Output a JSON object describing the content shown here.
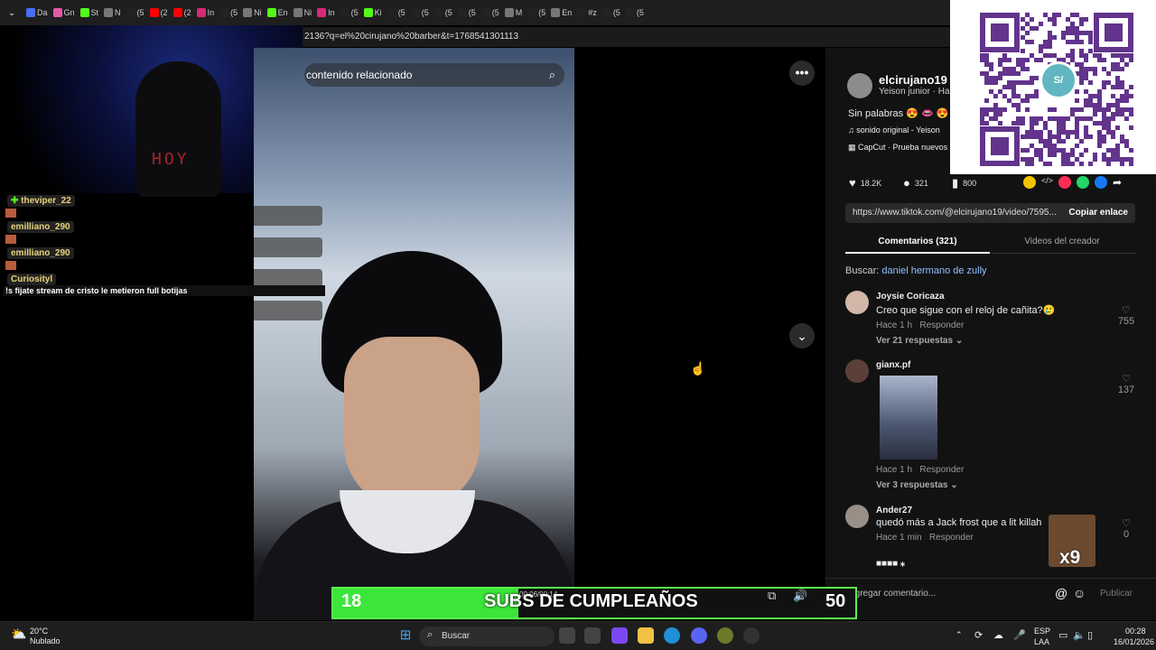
{
  "browser": {
    "tabs": [
      {
        "label": "Da",
        "color": "#4a6cf7"
      },
      {
        "label": "Gn",
        "color": "#e05aa5"
      },
      {
        "label": "St",
        "color": "#53fc18"
      },
      {
        "label": "N",
        "color": "#777"
      },
      {
        "label": "(5",
        "color": "#222"
      },
      {
        "label": "(2",
        "color": "#ff0000"
      },
      {
        "label": "(2",
        "color": "#ff0000"
      },
      {
        "label": "In",
        "color": "#d62976"
      },
      {
        "label": "(5",
        "color": "#222"
      },
      {
        "label": "Ni",
        "color": "#777"
      },
      {
        "label": "En",
        "color": "#53fc18"
      },
      {
        "label": "Ni",
        "color": "#777"
      },
      {
        "label": "In",
        "color": "#d62976"
      },
      {
        "label": "(5",
        "color": "#222"
      },
      {
        "label": "Ki",
        "color": "#53fc18"
      },
      {
        "label": "(5",
        "color": "#222"
      },
      {
        "label": "(5",
        "color": "#222"
      },
      {
        "label": "(5",
        "color": "#222"
      },
      {
        "label": "(5",
        "color": "#222"
      },
      {
        "label": "(5",
        "color": "#222"
      },
      {
        "label": "M",
        "color": "#777"
      },
      {
        "label": "(5",
        "color": "#222"
      },
      {
        "label": "En",
        "color": "#777"
      },
      {
        "label": "#z",
        "color": "#222"
      },
      {
        "label": "(5",
        "color": "#222"
      },
      {
        "label": "(5",
        "color": "#222"
      }
    ],
    "url": "2136?q=el%20cirujano%20barber&t=1768541301113"
  },
  "overlay": {
    "webcam_text": "HOY",
    "chat": [
      {
        "user": "theviper_22",
        "badge": "✚",
        "msg": ""
      },
      {
        "user": "emilliano_290",
        "badge": "",
        "msg": ""
      },
      {
        "user": "emilliano_290",
        "badge": "",
        "msg": ""
      },
      {
        "user": "Curiosityl",
        "badge": "",
        "msg": "!s fijate stream de cristo le metieron full botijas"
      }
    ],
    "subs_count": "18",
    "subs_title": "SUBS DE CUMPLEAÑOS",
    "subs_goal": "50",
    "time": "00:06/00:14",
    "meme": "x9"
  },
  "video": {
    "search_placeholder": "contenido relacionado",
    "search_icon": "search-icon",
    "more_label": "•••",
    "down_label": "⌄"
  },
  "post": {
    "author": "elcirujano19",
    "author_sub": "Yeison junior · Hac",
    "caption": "Sin palabras 😍 👄 😍 #",
    "sound": "♫  sonido original - Yeison",
    "capcut": "CapCut · Prueba nuevos",
    "likes": "18.2K",
    "comments": "321",
    "saves": "800",
    "link": "https://www.tiktok.com/@elcirujano19/video/7595...",
    "copy_label": "Copiar enlace",
    "tab_comments": "Comentarios (321)",
    "tab_videos": "Videos del creador",
    "search_prefix": "Buscar:",
    "search_term": "daniel hermano de zully"
  },
  "comments": [
    {
      "name": "Joysie Coricaza",
      "text": "Creo que sigue con el reloj de cañita?🥲",
      "time": "Hace 1 h",
      "reply": "Responder",
      "likes": "755",
      "replies": "Ver 21 respuestas ⌄"
    },
    {
      "name": "gianx.pf",
      "text": "",
      "time": "Hace 1 h",
      "reply": "Responder",
      "likes": "137",
      "replies": "Ver 3 respuestas ⌄"
    },
    {
      "name": "Ander27",
      "text": "quedó más a Jack frost que a lit killah",
      "time": "Hace 1 min",
      "reply": "Responder",
      "likes": "0",
      "replies": ""
    }
  ],
  "comment_partial": "■■■■ ⁎",
  "comment_input": {
    "placeholder": "Agregar comentario...",
    "post": "Publicar"
  },
  "taskbar": {
    "weather_temp": "20°C",
    "weather_desc": "Nublado",
    "search": "Buscar",
    "lang": "ESP",
    "lang2": "LAA",
    "time": "00:28",
    "date": "16/01/2026"
  },
  "colors": {
    "accent_green": "#3ce53a",
    "panel": "#121212",
    "yape": "#5a2a86"
  }
}
